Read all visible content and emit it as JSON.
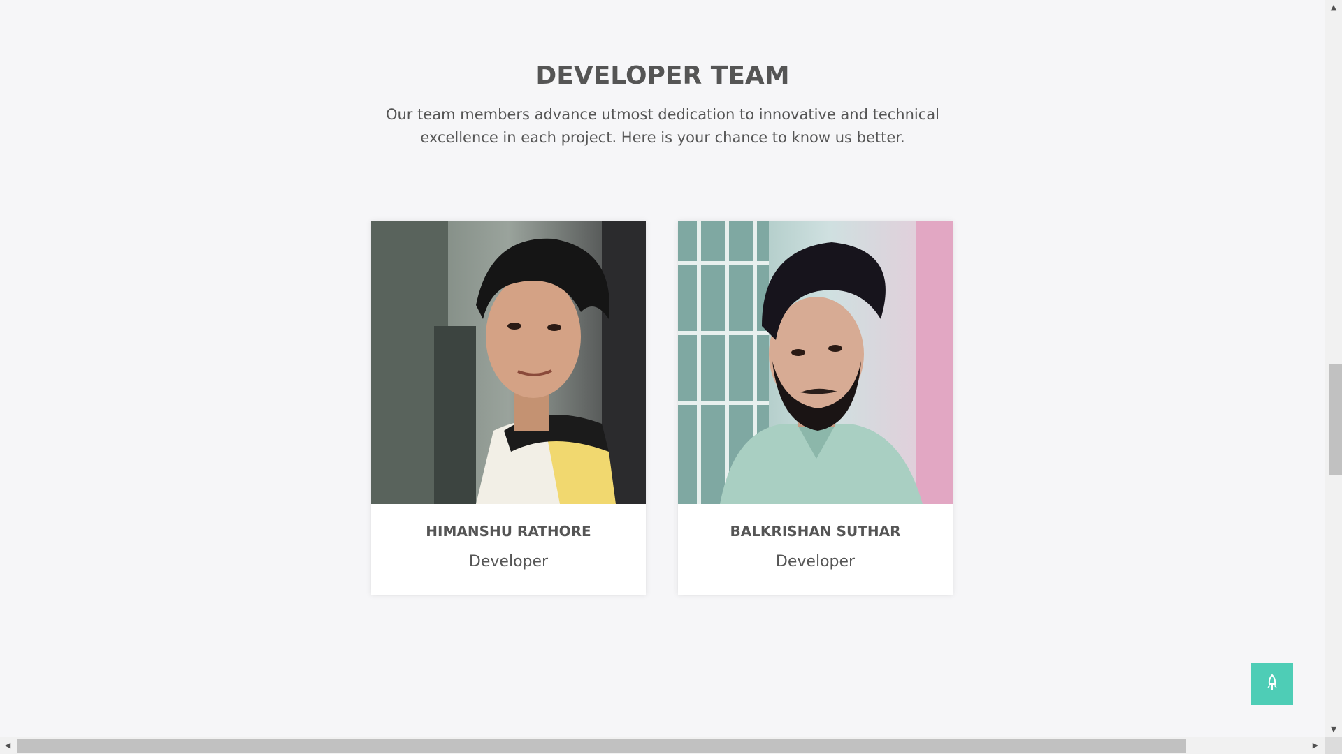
{
  "section": {
    "title": "DEVELOPER TEAM",
    "subtitle": "Our team members advance utmost dedication to innovative and technical excellence in each project. Here is your chance to know us better."
  },
  "team": [
    {
      "name": "HIMANSHU RATHORE",
      "role": "Developer"
    },
    {
      "name": "BALKRISHAN SUTHAR",
      "role": "Developer"
    }
  ],
  "back_to_top": {
    "icon": "rocket-icon",
    "color": "#4ecdb6"
  },
  "colors": {
    "background": "#f6f6f8",
    "text": "#555555",
    "card": "#ffffff"
  }
}
